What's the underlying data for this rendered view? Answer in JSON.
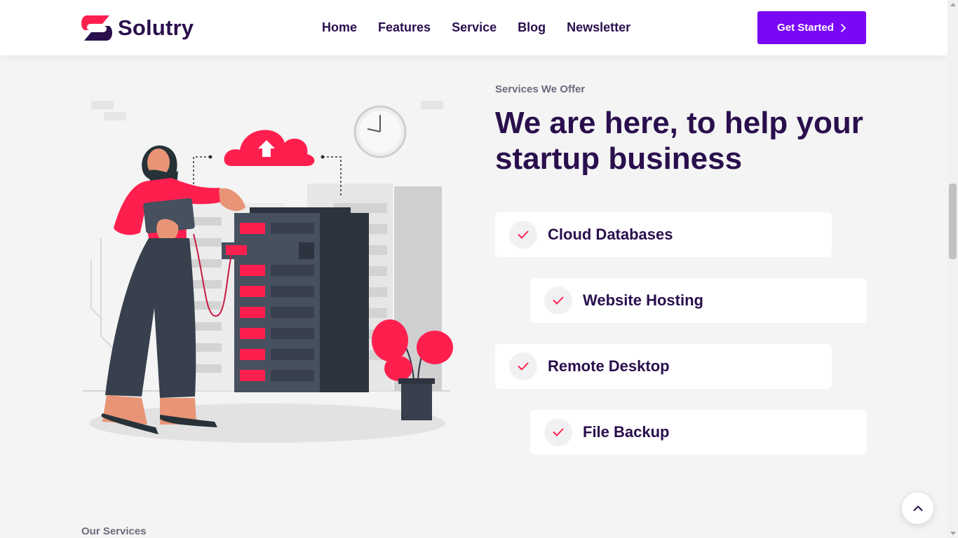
{
  "brand": {
    "name": "Solutry",
    "primary": "#2a0f4d",
    "accent": "#ff1f4f",
    "button": "#7a08f5"
  },
  "nav": {
    "items": [
      "Home",
      "Features",
      "Service",
      "Blog",
      "Newsletter"
    ]
  },
  "cta": {
    "label": "Get Started",
    "icon": "chevron-right-icon"
  },
  "section": {
    "eyebrow": "Services We Offer",
    "headline": "We are here, to help your startup business",
    "services": [
      {
        "label": "Cloud Databases",
        "icon": "check-icon"
      },
      {
        "label": "Website Hosting",
        "icon": "check-icon"
      },
      {
        "label": "Remote Desktop",
        "icon": "check-icon"
      },
      {
        "label": "File Backup",
        "icon": "check-icon"
      }
    ]
  },
  "next_section": {
    "eyebrow": "Our Services"
  },
  "back_to_top": {
    "icon": "arrow-up-icon"
  }
}
